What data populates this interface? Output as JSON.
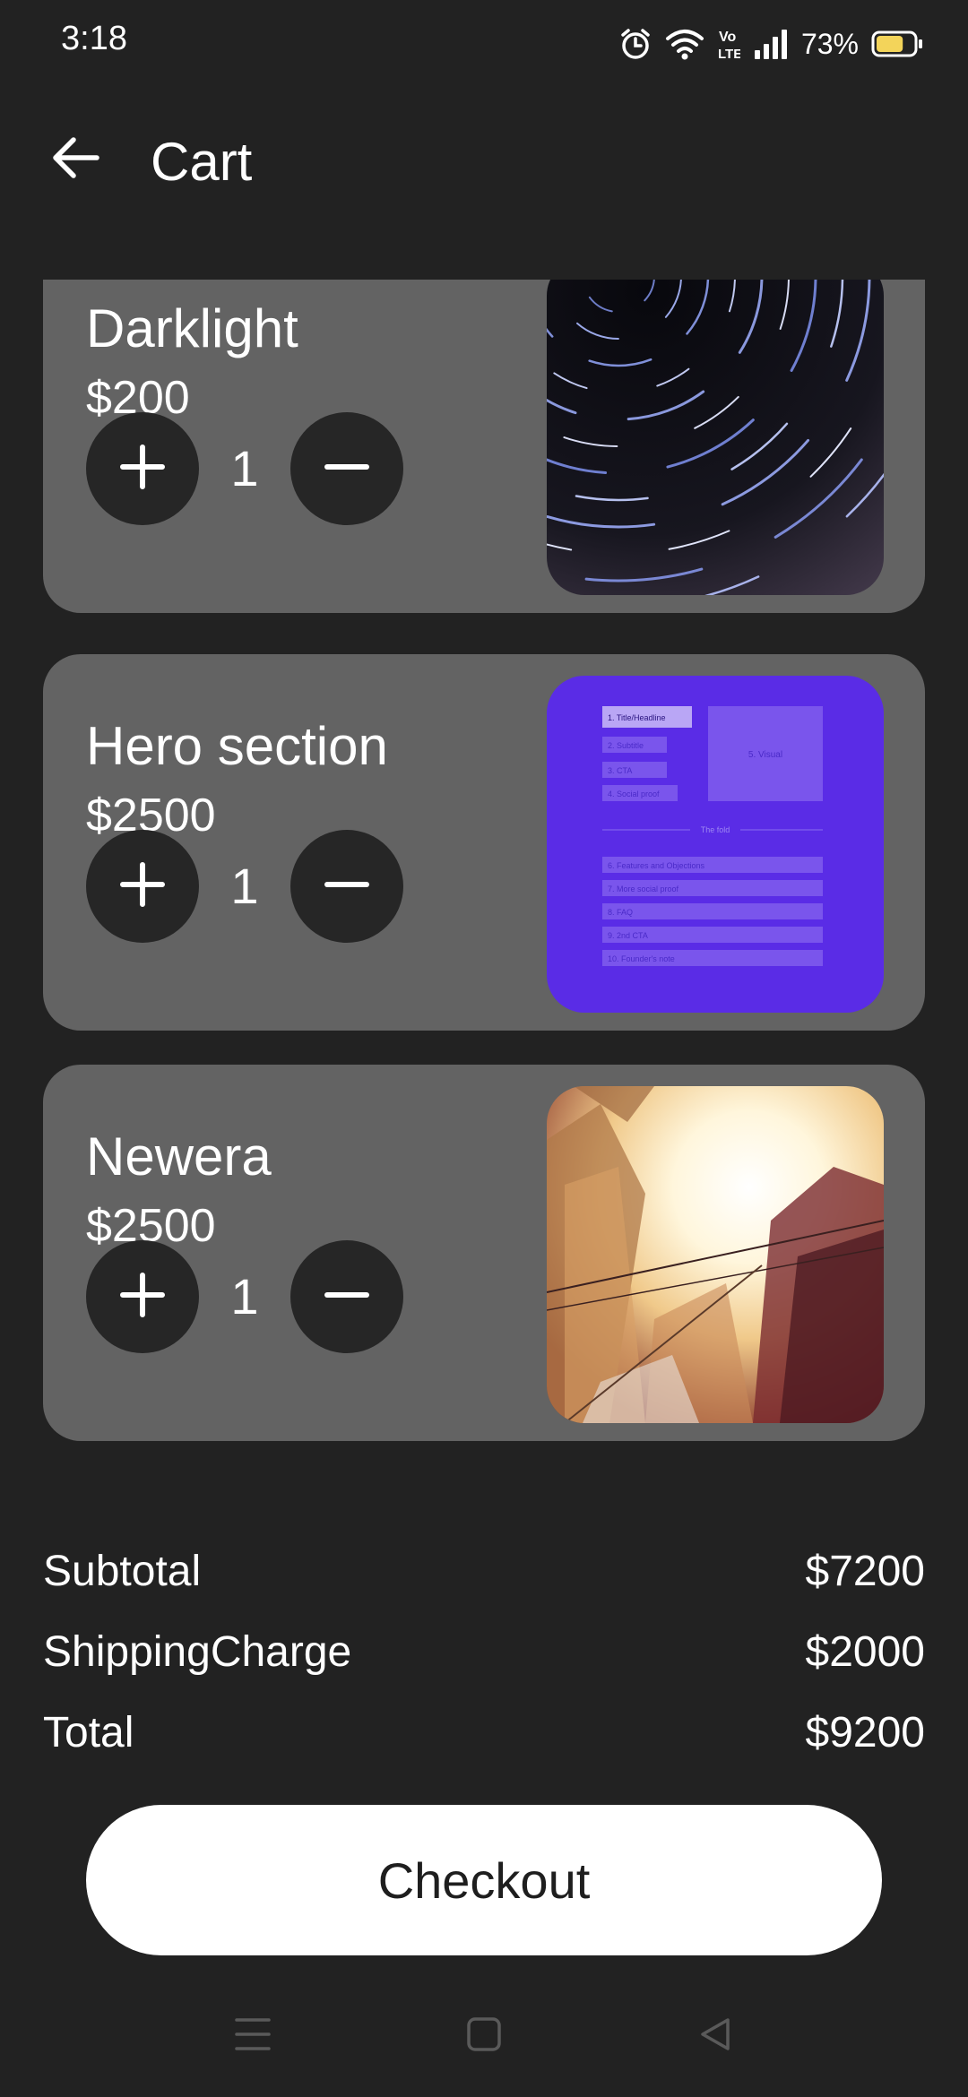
{
  "status_bar": {
    "time": "3:18",
    "battery_percent": "73%",
    "icons": [
      "alarm-icon",
      "wifi-icon",
      "volte-icon",
      "signal-icon",
      "battery-icon"
    ],
    "battery_level": 0.73
  },
  "header": {
    "title": "Cart",
    "back_icon": "arrow-left-icon"
  },
  "cart": {
    "items": [
      {
        "name": "Darklight",
        "price": "$200",
        "quantity": "1",
        "image": "star-trails-night-sky"
      },
      {
        "name": "Hero section",
        "price": "$2500",
        "quantity": "1",
        "image": "hero-section-wireframe"
      },
      {
        "name": "Newera",
        "price": "$2500",
        "quantity": "1",
        "image": "city-fisheye-sunlight"
      }
    ],
    "wireframe": {
      "left_labels": [
        "1. Title/Headline",
        "2. Subtitle",
        "3. CTA",
        "4. Social proof"
      ],
      "visual_label": "5. Visual",
      "fold_label": "The fold",
      "bottom_labels": [
        "6. Features and Objections",
        "7. More social proof",
        "8. FAQ",
        "9. 2nd CTA",
        "10. Founder's note"
      ]
    }
  },
  "summary": {
    "subtotal_label": "Subtotal",
    "subtotal_value": "$7200",
    "shipping_label": "ShippingCharge",
    "shipping_value": "$2000",
    "total_label": "Total",
    "total_value": "$9200"
  },
  "checkout": {
    "label": "Checkout"
  },
  "nav": {
    "icons": [
      "menu-icon",
      "home-square-icon",
      "back-triangle-icon"
    ]
  },
  "colors": {
    "background": "#222222",
    "card": "#636363",
    "qty_button": "#262626",
    "wireframe_purple": "#5a2ce6",
    "battery_fill": "#f3d45a"
  }
}
